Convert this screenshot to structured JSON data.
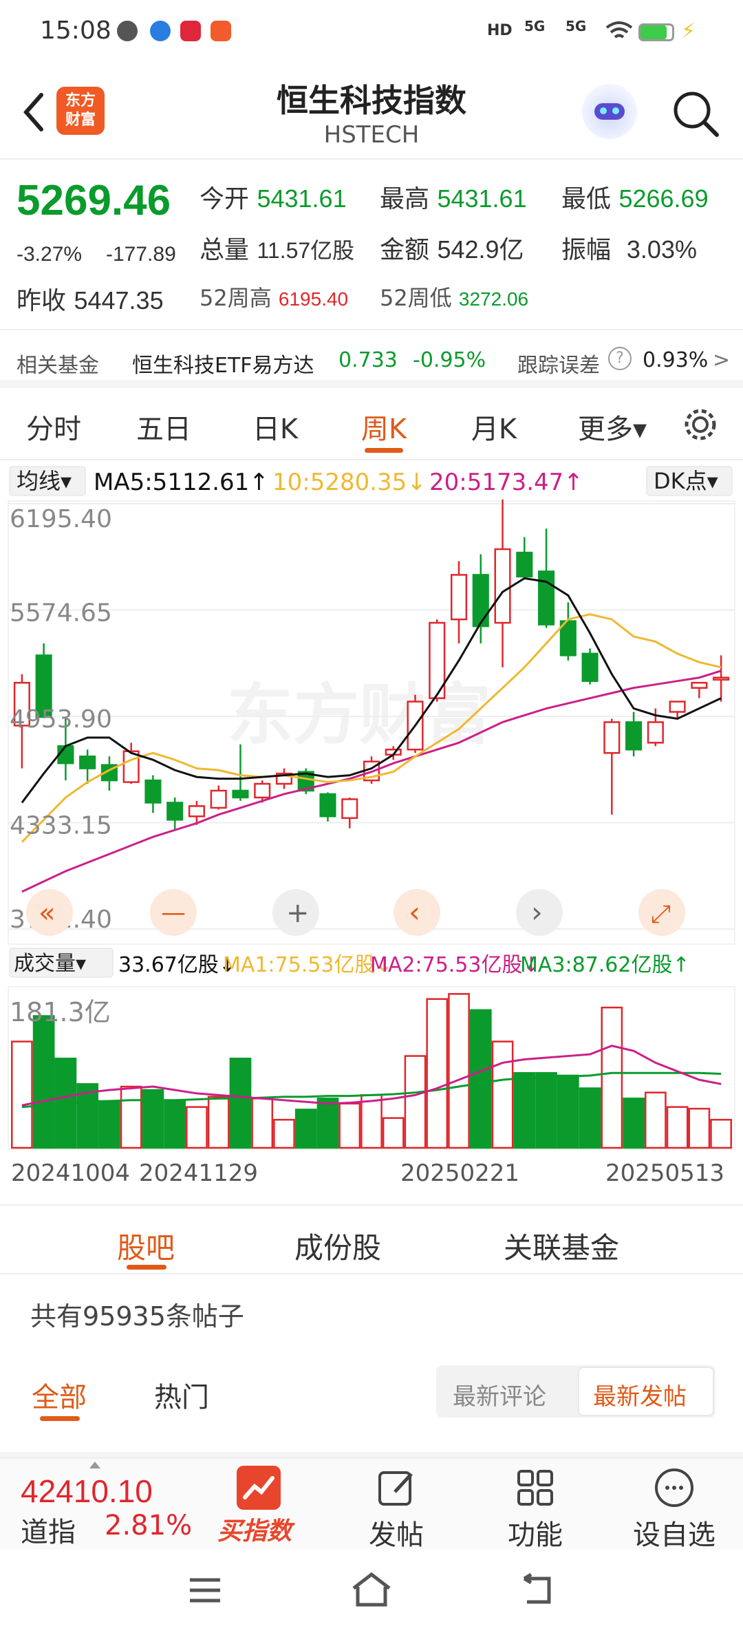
{
  "status": {
    "time": "15:08",
    "net1": "5G",
    "net2": "5G",
    "hd": "HD"
  },
  "header": {
    "logo_top": "东方",
    "logo_bottom": "财富",
    "title": "恒生科技指数",
    "subtitle": "HSTECH"
  },
  "quote": {
    "price": "5269.46",
    "change_pct": "-3.27%",
    "change": "-177.89",
    "open_label": "今开",
    "open": "5431.61",
    "high_label": "最高",
    "high": "5431.61",
    "low_label": "最低",
    "low": "5266.69",
    "vol_label": "总量",
    "vol": "11.57亿股",
    "amt_label": "金额",
    "amt": "542.9亿",
    "amp_label": "振幅",
    "amp": "3.03%",
    "prev_label": "昨收",
    "prev": "5447.35",
    "w52h_label": "52周高",
    "w52h": "6195.40",
    "w52l_label": "52周低",
    "w52l": "3272.06"
  },
  "fund": {
    "label": "相关基金",
    "name": "恒生科技ETF易方达",
    "price": "0.733",
    "pct": "-0.95%",
    "err_label": "跟踪误差",
    "err_icon": "?",
    "err": "0.93%",
    "arrow": ">"
  },
  "tabs": [
    "分时",
    "五日",
    "日K",
    "周K",
    "月K",
    "更多▾"
  ],
  "active_tab": 3,
  "kline": {
    "ma_select": "均线▾",
    "ma5": "MA5:5112.61↑",
    "ma10": "10:5280.35↓",
    "ma20": "20:5173.47↑",
    "dk": "DK点▾",
    "watermark": "东方财富",
    "ylabels": [
      "6195.40",
      "5574.65",
      "4953.90",
      "4333.15",
      "3712.40"
    ],
    "ylim": [
      3712.4,
      6195.4
    ],
    "vol_select": "成交量▾",
    "vol_now": "33.67亿股↓",
    "vma1": "MA1:75.53亿股↓",
    "vma2": "MA2:75.53亿股↓",
    "vma3": "MA3:87.62亿股↑",
    "vol_max": "181.3亿",
    "xlabels": [
      "20241004",
      "20241129",
      "20250221",
      "20250513"
    ],
    "colors": {
      "up": "#e0262b",
      "down": "#0a9b2c",
      "ma5": "#111111",
      "ma10": "#f0b830",
      "ma20": "#cc1f88",
      "vma3": "#0a9b2c"
    }
  },
  "chart_data": {
    "type": "candlestick",
    "ylim": [
      3712.4,
      6195.4
    ],
    "candles": [
      [
        4900,
        5150,
        5200,
        4650
      ],
      [
        5310,
        4950,
        5380,
        4950
      ],
      [
        4780,
        4680,
        4950,
        4580
      ],
      [
        4720,
        4650,
        4760,
        4560
      ],
      [
        4670,
        4580,
        4720,
        4520
      ],
      [
        4570,
        4750,
        4800,
        4560
      ],
      [
        4580,
        4450,
        4610,
        4390
      ],
      [
        4450,
        4350,
        4480,
        4290
      ],
      [
        4370,
        4430,
        4460,
        4320
      ],
      [
        4420,
        4520,
        4550,
        4410
      ],
      [
        4520,
        4480,
        4790,
        4460
      ],
      [
        4480,
        4560,
        4580,
        4450
      ],
      [
        4560,
        4620,
        4650,
        4530
      ],
      [
        4630,
        4520,
        4650,
        4500
      ],
      [
        4500,
        4370,
        4510,
        4340
      ],
      [
        4360,
        4470,
        4480,
        4300
      ],
      [
        4580,
        4690,
        4720,
        4560
      ],
      [
        4730,
        4760,
        4780,
        4700
      ],
      [
        4760,
        5040,
        5080,
        4740
      ],
      [
        5060,
        5500,
        5520,
        5040
      ],
      [
        5520,
        5780,
        5860,
        5380
      ],
      [
        5780,
        5480,
        5900,
        5380
      ],
      [
        5500,
        5930,
        6220,
        5240
      ],
      [
        5910,
        5770,
        6000,
        5760
      ],
      [
        5800,
        5490,
        6050,
        5470
      ],
      [
        5510,
        5310,
        5620,
        5280
      ],
      [
        5320,
        5160,
        5350,
        5140
      ],
      [
        4740,
        4920,
        4940,
        4380
      ],
      [
        4920,
        4760,
        4980,
        4720
      ],
      [
        4800,
        4920,
        5000,
        4780
      ],
      [
        4980,
        5040,
        5040,
        4940
      ],
      [
        5120,
        5150,
        5150,
        5060
      ],
      [
        5180,
        5180,
        5310,
        5040
      ]
    ],
    "ma5": [
      4450,
      4620,
      4780,
      4830,
      4830,
      4740,
      4700,
      4640,
      4600,
      4590,
      4590,
      4600,
      4610,
      4620,
      4600,
      4610,
      4650,
      4730,
      4900,
      5080,
      5280,
      5500,
      5680,
      5760,
      5740,
      5660,
      5440,
      5200,
      5000,
      4960,
      4940,
      5000,
      5060
    ],
    "ma10": [
      4220,
      4350,
      4480,
      4570,
      4640,
      4700,
      4740,
      4700,
      4650,
      4640,
      4610,
      4600,
      4610,
      4590,
      4570,
      4580,
      4600,
      4630,
      4720,
      4800,
      4880,
      5000,
      5120,
      5240,
      5380,
      5520,
      5550,
      5520,
      5420,
      5390,
      5320,
      5270,
      5240
    ],
    "ma20": [
      3930,
      3990,
      4050,
      4100,
      4150,
      4200,
      4250,
      4290,
      4330,
      4380,
      4420,
      4460,
      4500,
      4530,
      4560,
      4590,
      4630,
      4680,
      4720,
      4760,
      4800,
      4860,
      4920,
      4960,
      5000,
      5030,
      5060,
      5090,
      5120,
      5140,
      5160,
      5180,
      5220
    ],
    "volume": {
      "max": 181.3,
      "values": [
        125,
        155,
        105,
        75,
        55,
        72,
        68,
        55,
        48,
        60,
        105,
        58,
        33,
        45,
        58,
        52,
        62,
        35,
        108,
        175,
        181,
        162,
        125,
        88,
        88,
        85,
        70,
        165,
        58,
        65,
        48,
        46,
        33
      ],
      "ma_pink": [
        50,
        55,
        60,
        65,
        68,
        70,
        72,
        68,
        64,
        62,
        60,
        58,
        56,
        54,
        52,
        53,
        55,
        58,
        62,
        70,
        80,
        90,
        100,
        104,
        106,
        108,
        110,
        120,
        114,
        100,
        90,
        80,
        75
      ],
      "ma_green": [
        48,
        50,
        52,
        54,
        55,
        56,
        56,
        56,
        57,
        58,
        58,
        59,
        60,
        60,
        61,
        61,
        62,
        63,
        65,
        68,
        72,
        76,
        80,
        82,
        83,
        84,
        85,
        88,
        88,
        88,
        88,
        88,
        87
      ]
    }
  },
  "kline_controls": [
    "«",
    "—",
    "+",
    "‹",
    "›",
    "⤢"
  ],
  "posts": {
    "tabs": [
      "股吧",
      "成份股",
      "关联基金"
    ],
    "count": "共有95935条帖子",
    "sub_all": "全部",
    "sub_hot": "热门",
    "sort1": "最新评论",
    "sort2": "最新发帖"
  },
  "bottom": {
    "index_value": "42410.10",
    "index_name": "道指",
    "index_pct": "2.81%",
    "buy": "买指数",
    "post": "发帖",
    "func": "功能",
    "fav": "设自选"
  }
}
